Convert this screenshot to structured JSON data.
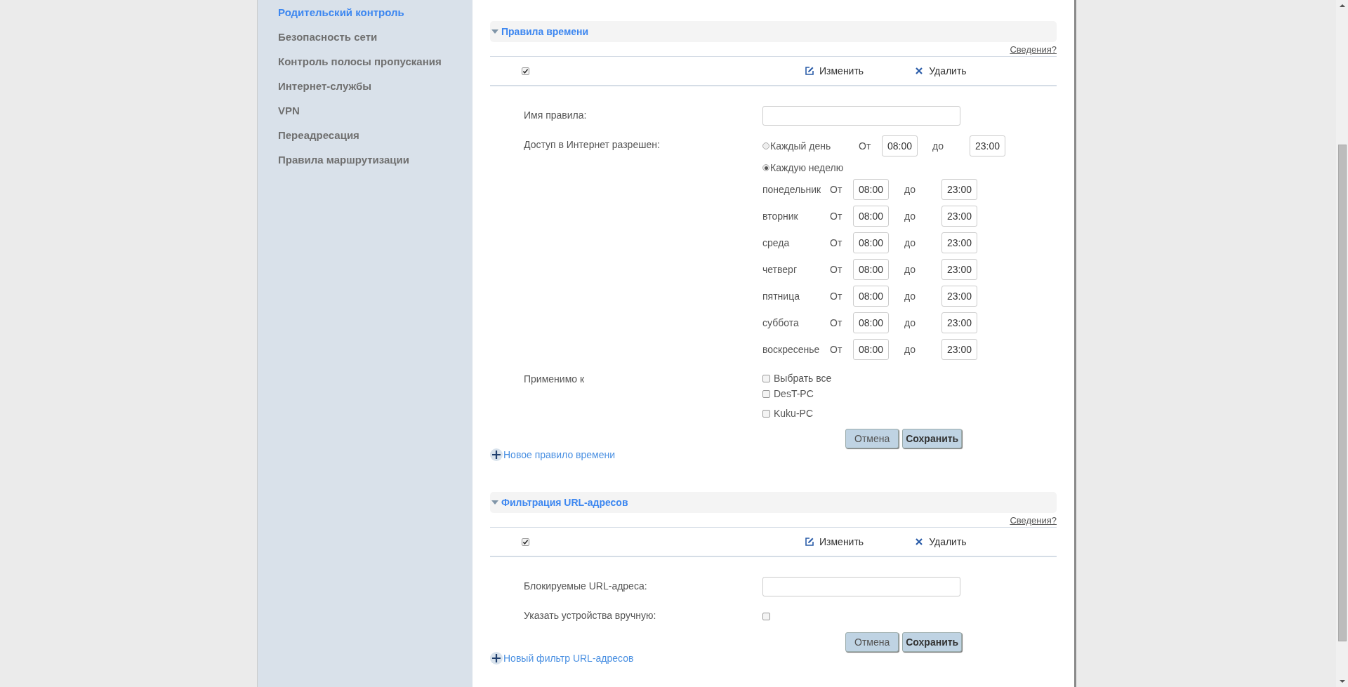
{
  "sidebar": {
    "items": [
      {
        "label": "Родительский контроль",
        "selected": true
      },
      {
        "label": "Безопасность сети",
        "selected": false
      },
      {
        "label": "Контроль полосы пропускания",
        "selected": false
      },
      {
        "label": "Интернет-службы",
        "selected": false
      },
      {
        "label": "VPN",
        "selected": false
      },
      {
        "label": "Переадресация",
        "selected": false
      },
      {
        "label": "Правила маршрутизации",
        "selected": false
      }
    ]
  },
  "sections": [
    {
      "title": "Правила времени",
      "expanded": true,
      "info_link": "Сведения?",
      "toolbar": {
        "checked": true,
        "edit": "Изменить",
        "delete": "Удалить"
      },
      "fields": [
        {
          "kind": "text",
          "label": "Имя правила:"
        },
        {
          "kind": "schedule",
          "label": "Доступ в Интернет разрешен:",
          "options": [
            {
              "label": "Каждый день",
              "selected": false,
              "from_label": "От",
              "from": "08:00",
              "to_label": "до",
              "to": "23:00"
            },
            {
              "label": "Каждую неделю",
              "selected": true,
              "days": [
                {
                  "day": "понедельник",
                  "from_label": "От",
                  "from": "08:00",
                  "to_label": "до",
                  "to": "23:00"
                },
                {
                  "day": "вторник",
                  "from_label": "От",
                  "from": "08:00",
                  "to_label": "до",
                  "to": "23:00"
                },
                {
                  "day": "среда",
                  "from_label": "От",
                  "from": "08:00",
                  "to_label": "до",
                  "to": "23:00"
                },
                {
                  "day": "четверг",
                  "from_label": "От",
                  "from": "08:00",
                  "to_label": "до",
                  "to": "23:00"
                },
                {
                  "day": "пятница",
                  "from_label": "От",
                  "from": "08:00",
                  "to_label": "до",
                  "to": "23:00"
                },
                {
                  "day": "суббота",
                  "from_label": "От",
                  "from": "08:00",
                  "to_label": "до",
                  "to": "23:00"
                },
                {
                  "day": "воскресенье",
                  "from_label": "От",
                  "from": "08:00",
                  "to_label": "до",
                  "to": "23:00"
                }
              ]
            }
          ]
        },
        {
          "kind": "checklist",
          "label": "Применимо к",
          "items": [
            {
              "label": "Выбрать все",
              "checked": false
            },
            {
              "label": "DesT-PC",
              "checked": false
            },
            {
              "label": "Kuku-PC",
              "checked": false
            }
          ]
        }
      ],
      "buttons": [
        "Отмена",
        "Сохранить"
      ],
      "add_link": "Новое правило времени"
    },
    {
      "title": "Фильтрация URL-адресов",
      "expanded": true,
      "info_link": "Сведения?",
      "toolbar": {
        "checked": true,
        "edit": "Изменить",
        "delete": "Удалить"
      },
      "fields": [
        {
          "kind": "text",
          "label": "Блокируемые URL-адреса:"
        },
        {
          "kind": "checkbox",
          "label": "Указать устройства вручную:",
          "checked": false
        }
      ],
      "buttons": [
        "Отмена",
        "Сохранить"
      ],
      "add_link": "Новый фильтр URL-адресов"
    }
  ]
}
